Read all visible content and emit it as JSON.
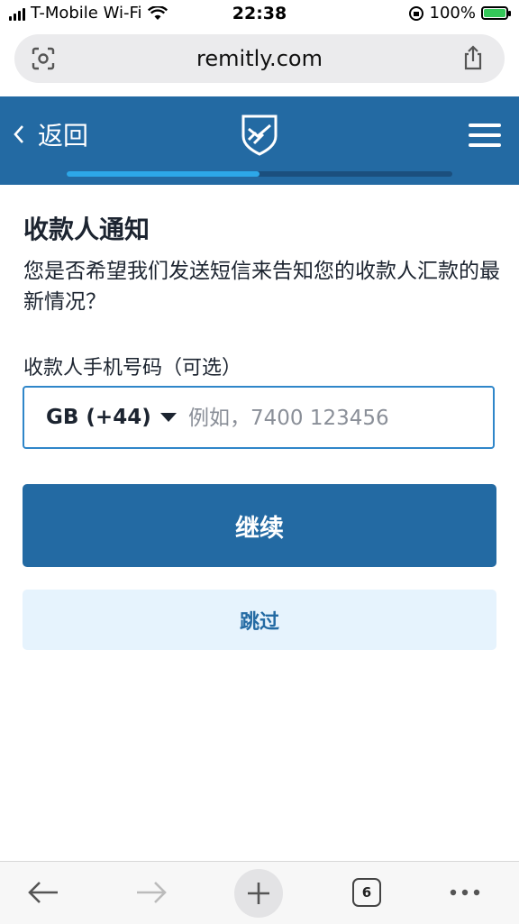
{
  "status_bar": {
    "carrier": "T-Mobile Wi-Fi",
    "time": "22:38",
    "battery": "100%"
  },
  "browser": {
    "url": "remitly.com",
    "open_tabs": "6",
    "icons": {
      "left": "page-scan-icon",
      "share": "share-icon",
      "back": "arrow-left-icon",
      "forward": "arrow-right-icon",
      "new_tab": "plus-icon",
      "more": "more-dots-icon"
    }
  },
  "header": {
    "back_label": "返回",
    "logo": "remitly-logo",
    "menu": "hamburger-icon",
    "progress": 0.5,
    "colors": {
      "background": "#236aa3",
      "progress_fill": "#2da7e8",
      "progress_track": "#1b4f7e"
    }
  },
  "main": {
    "title": "收款人通知",
    "description": "您是否希望我们发送短信来告知您的收款人汇款的最新情况？",
    "phone_label": "收款人手机号码（可选）",
    "country_code": "GB (+44)",
    "phone_placeholder": "例如，7400 123456",
    "phone_value": "",
    "continue_label": "继续",
    "skip_label": "跳过"
  }
}
